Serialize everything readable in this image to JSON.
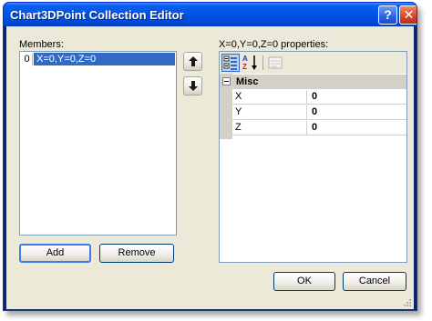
{
  "window": {
    "title": "Chart3DPoint Collection Editor",
    "help_label": "?",
    "close_label": "✕",
    "colors": {
      "titlebar": "#0054e3",
      "client": "#ece9d8",
      "selection": "#316ac5"
    }
  },
  "members": {
    "label": "Members:",
    "items": [
      {
        "index": "0",
        "text": "X=0,Y=0,Z=0",
        "selected": true
      }
    ],
    "add_label": "Add",
    "remove_label": "Remove"
  },
  "properties": {
    "label": "X=0,Y=0,Z=0 properties:",
    "toolbar": [
      "categorized-icon",
      "alphabetical-icon",
      "property-pages-icon"
    ],
    "category": "Misc",
    "rows": [
      {
        "name": "X",
        "value": "0"
      },
      {
        "name": "Y",
        "value": "0"
      },
      {
        "name": "Z",
        "value": "0"
      }
    ]
  },
  "footer": {
    "ok_label": "OK",
    "cancel_label": "Cancel"
  }
}
